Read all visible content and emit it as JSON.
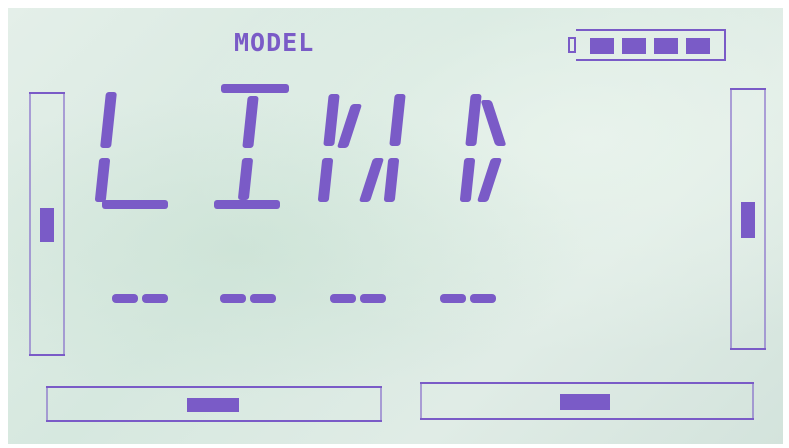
{
  "screen": {
    "model_label": "MODEL",
    "main_text": "LINK",
    "placeholder_dashes": [
      "--",
      "--",
      "--",
      "--"
    ],
    "ink_color": "#7a5bc7",
    "background_color": "#dceae3"
  },
  "battery": {
    "segments_filled": 4,
    "segments_total": 4
  },
  "trims": {
    "left_vertical": {
      "position_fraction": 0.47
    },
    "right_vertical": {
      "position_fraction": 0.5
    },
    "bottom_left_horizontal": {
      "position_fraction": 0.5
    },
    "bottom_right_horizontal": {
      "position_fraction": 0.5
    }
  }
}
